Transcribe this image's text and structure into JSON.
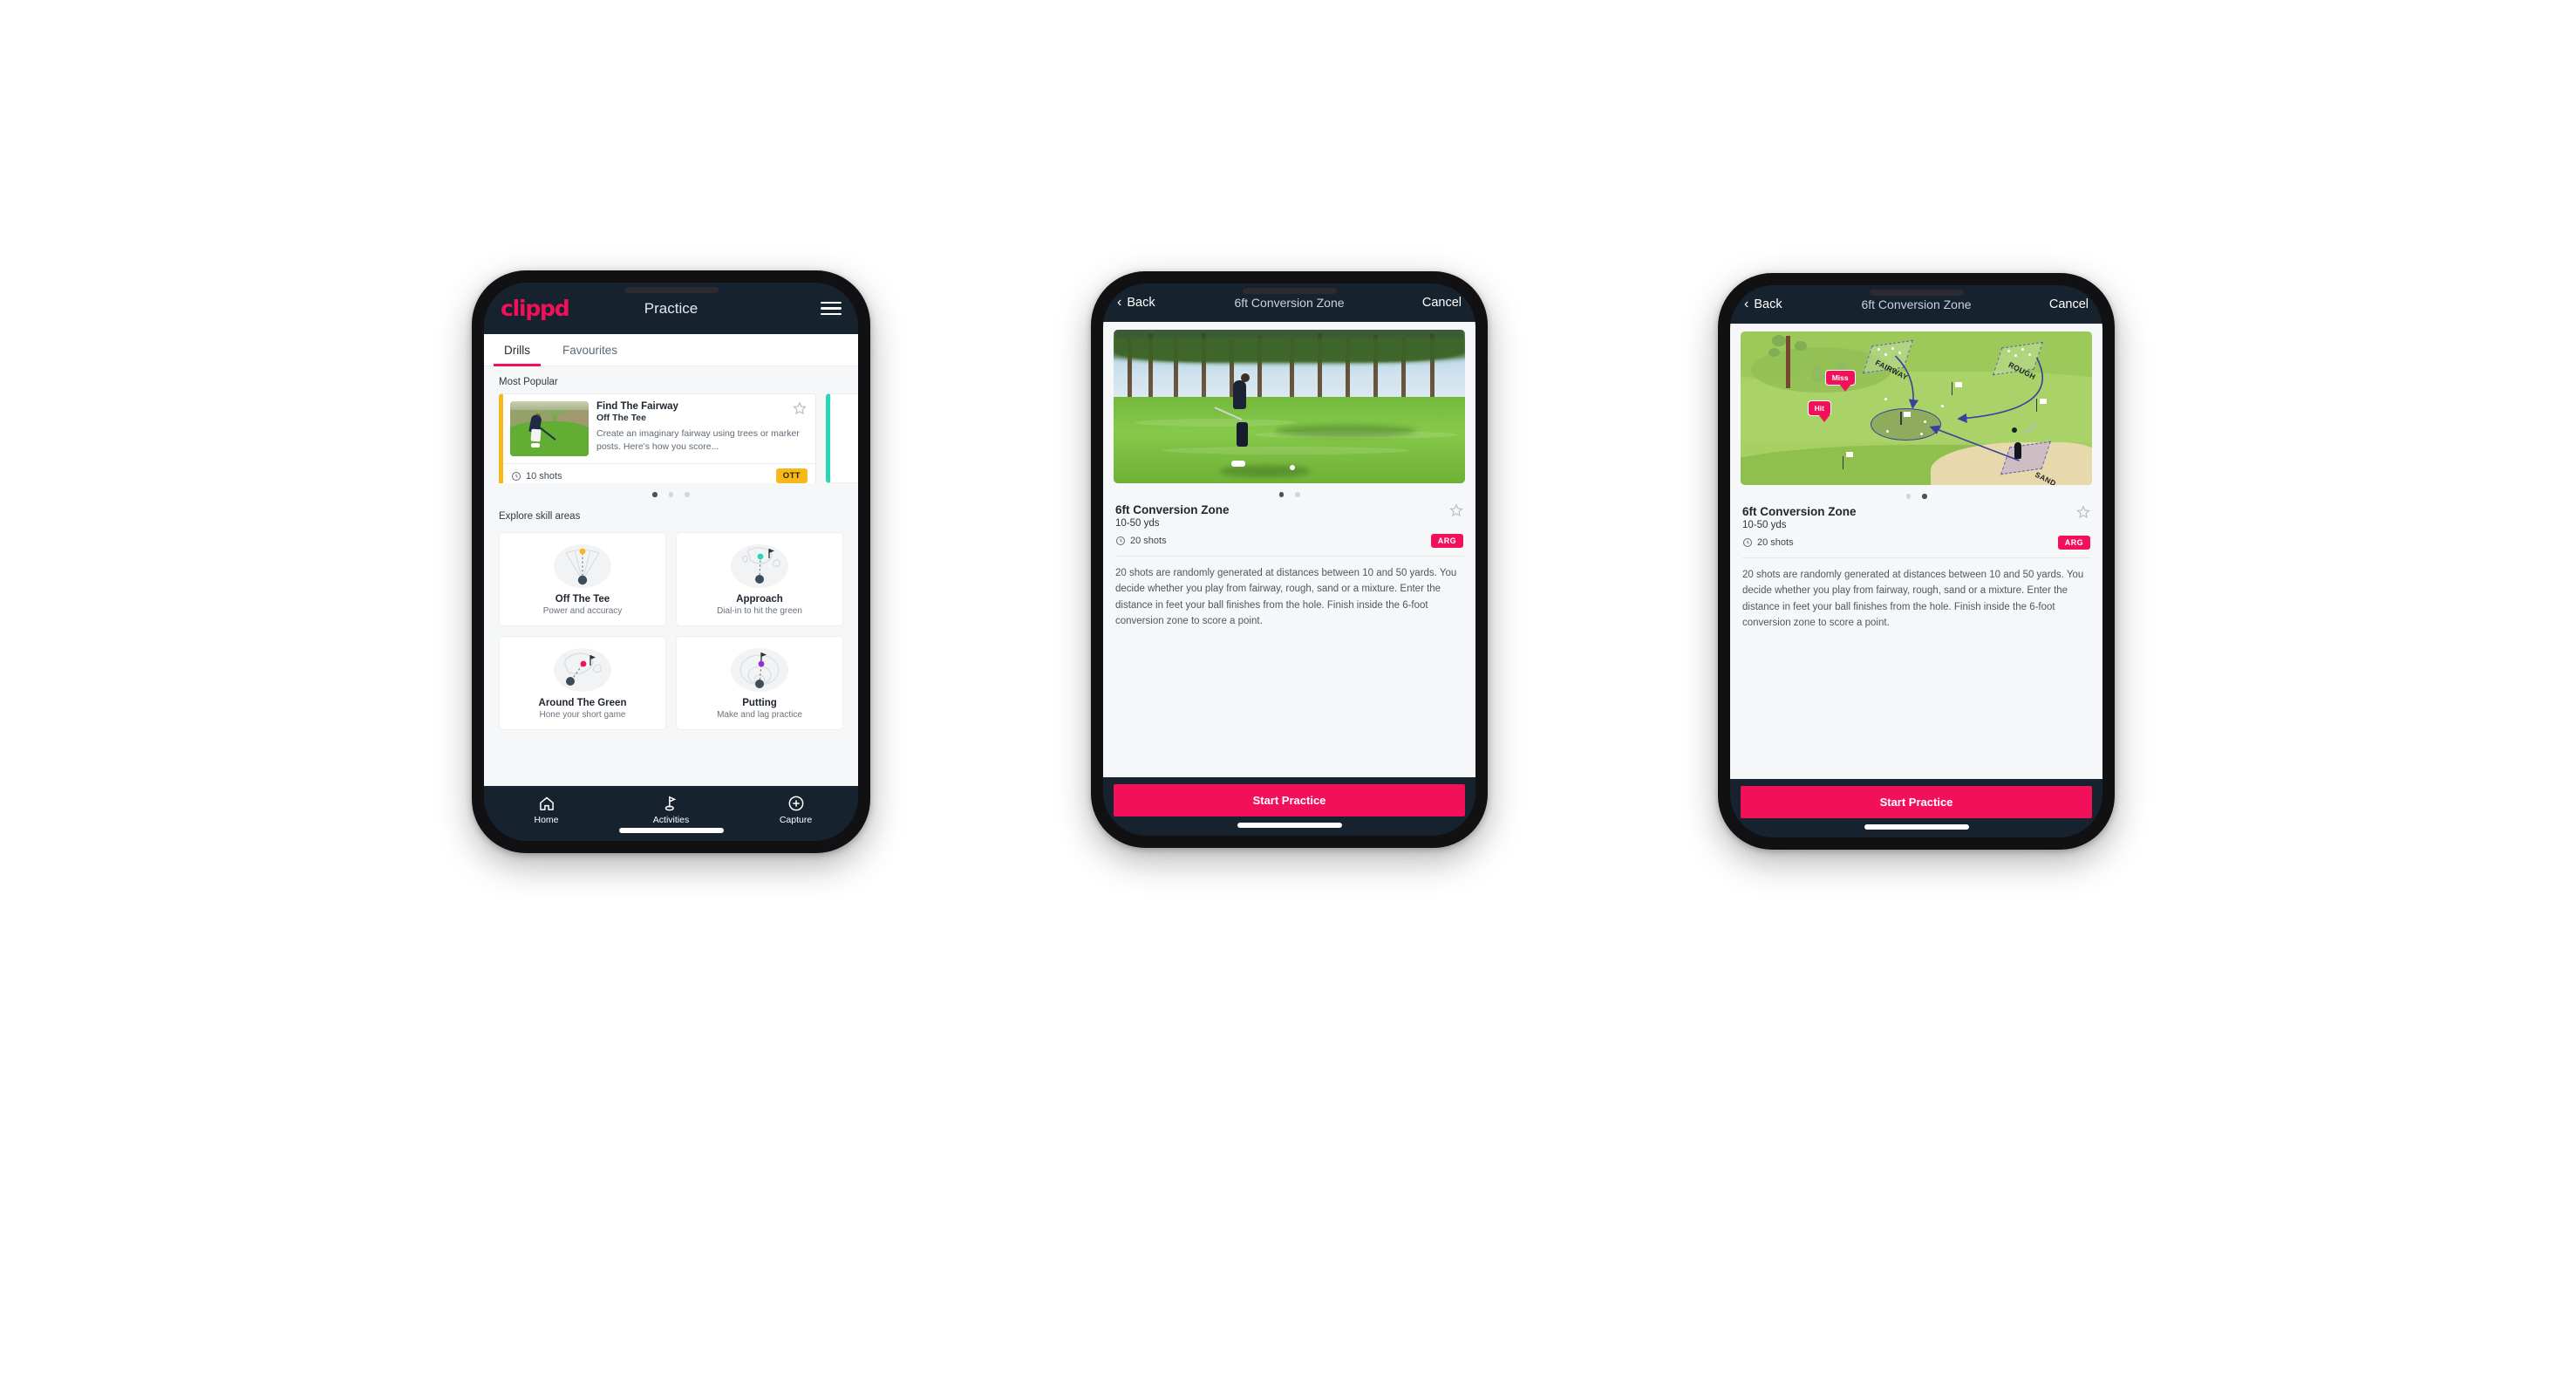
{
  "phone1": {
    "topbar": {
      "logo": "clippd",
      "title": "Practice",
      "menu_icon": "hamburger-menu-icon"
    },
    "tabs": [
      {
        "label": "Drills",
        "active": true
      },
      {
        "label": "Favourites",
        "active": false
      }
    ],
    "most_popular_label": "Most Popular",
    "drill_card": {
      "title": "Find The Fairway",
      "subtitle": "Off The Tee",
      "description": "Create an imaginary fairway using trees or marker posts. Here's how you score...",
      "shots": "10 shots",
      "badge": "OTT",
      "badge_color": "#f6b81a",
      "accent_color": "#f6b81a",
      "favourite_icon": "star-outline-icon",
      "shots_icon": "clock-icon"
    },
    "peek_card_accent": "#2bd6b4",
    "carousel_dots": {
      "count": 3,
      "active_index": 0
    },
    "explore_label": "Explore skill areas",
    "skills": [
      {
        "name": "Off The Tee",
        "desc": "Power and accuracy",
        "icon": "tee-shot-dispersion-icon",
        "dot_color": "#f6b81a"
      },
      {
        "name": "Approach",
        "desc": "Dial-in to hit the green",
        "icon": "approach-green-icon",
        "dot_color": "#2bd6b4"
      },
      {
        "name": "Around The Green",
        "desc": "Hone your short game",
        "icon": "chip-around-green-icon",
        "dot_color": "#f2105a"
      },
      {
        "name": "Putting",
        "desc": "Make and lag practice",
        "icon": "putting-rings-icon",
        "dot_color": "#9b2fd6"
      }
    ],
    "nav": [
      {
        "label": "Home",
        "icon": "home-icon",
        "active": false
      },
      {
        "label": "Activities",
        "icon": "golf-flag-icon",
        "active": true
      },
      {
        "label": "Capture",
        "icon": "plus-circle-icon",
        "active": false
      }
    ]
  },
  "phone2": {
    "header": {
      "back": "Back",
      "title": "6ft Conversion Zone",
      "cancel": "Cancel",
      "back_icon": "chevron-left-icon"
    },
    "media_type": "photo-golfer-chipping",
    "carousel_dots": {
      "count": 2,
      "active_index": 0
    },
    "name": "6ft Conversion Zone",
    "yardage": "10-50 yds",
    "shots": "20 shots",
    "shots_icon": "clock-icon",
    "badge": "ARG",
    "badge_color": "#f2105a",
    "favourite_icon": "star-outline-icon",
    "description": "20 shots are randomly generated at distances between 10 and 50 yards. You decide whether you play from fairway, rough, sand or a mixture. Enter the distance in feet your ball finishes from the hole. Finish inside the 6-foot conversion zone to score a point.",
    "cta": "Start Practice"
  },
  "phone3": {
    "header": {
      "back": "Back",
      "title": "6ft Conversion Zone",
      "cancel": "Cancel",
      "back_icon": "chevron-left-icon"
    },
    "media_type": "course-diagram",
    "map_labels": {
      "fairway": "FAIRWAY",
      "rough": "ROUGH",
      "sand": "SAND",
      "miss": "Miss",
      "hit": "Hit"
    },
    "carousel_dots": {
      "count": 2,
      "active_index": 1
    },
    "name": "6ft Conversion Zone",
    "yardage": "10-50 yds",
    "shots": "20 shots",
    "shots_icon": "clock-icon",
    "badge": "ARG",
    "badge_color": "#f2105a",
    "favourite_icon": "star-outline-icon",
    "description": "20 shots are randomly generated at distances between 10 and 50 yards. You decide whether you play from fairway, rough, sand or a mixture. Enter the distance in feet your ball finishes from the hole. Finish inside the 6-foot conversion zone to score a point.",
    "cta": "Start Practice"
  }
}
